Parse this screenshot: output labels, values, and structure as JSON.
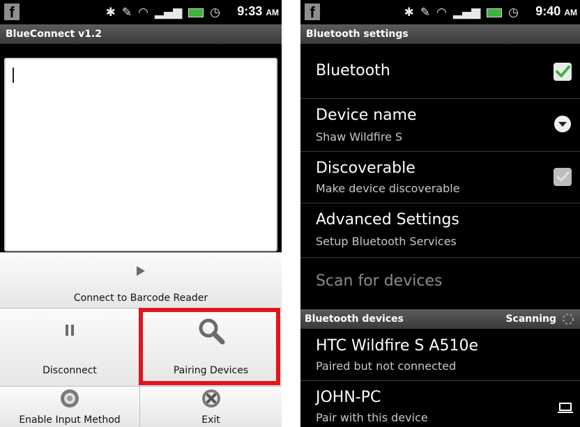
{
  "left": {
    "status": {
      "time": "9:33",
      "ampm": "AM"
    },
    "app_title": "BlueConnect v1.2",
    "menu": {
      "connect": "Connect to Barcode Reader",
      "disconnect": "Disconnect",
      "pairing": "Pairing Devices",
      "enable_input": "Enable Input Method",
      "exit": "Exit"
    }
  },
  "right": {
    "status": {
      "time": "9:40",
      "ampm": "AM"
    },
    "title": "Bluetooth settings",
    "rows": {
      "bluetooth": {
        "title": "Bluetooth",
        "checked": true
      },
      "device_name": {
        "title": "Device name",
        "subtitle": "Shaw Wildfire S"
      },
      "discoverable": {
        "title": "Discoverable",
        "subtitle": "Make device discoverable",
        "checked": false
      },
      "advanced": {
        "title": "Advanced Settings",
        "subtitle": "Setup Bluetooth Services"
      },
      "scan": {
        "title": "Scan for devices"
      }
    },
    "devices_section": {
      "label": "Bluetooth devices",
      "status": "Scanning"
    },
    "devices": [
      {
        "name": "HTC Wildfire S A510e",
        "status": "Paired but not connected",
        "icon": "phone-icon"
      },
      {
        "name": "JOHN-PC",
        "status": "Pair with this device",
        "icon": "laptop-icon"
      }
    ]
  },
  "colors": {
    "highlight": "#e3141b",
    "check_green": "#3cb43c"
  }
}
